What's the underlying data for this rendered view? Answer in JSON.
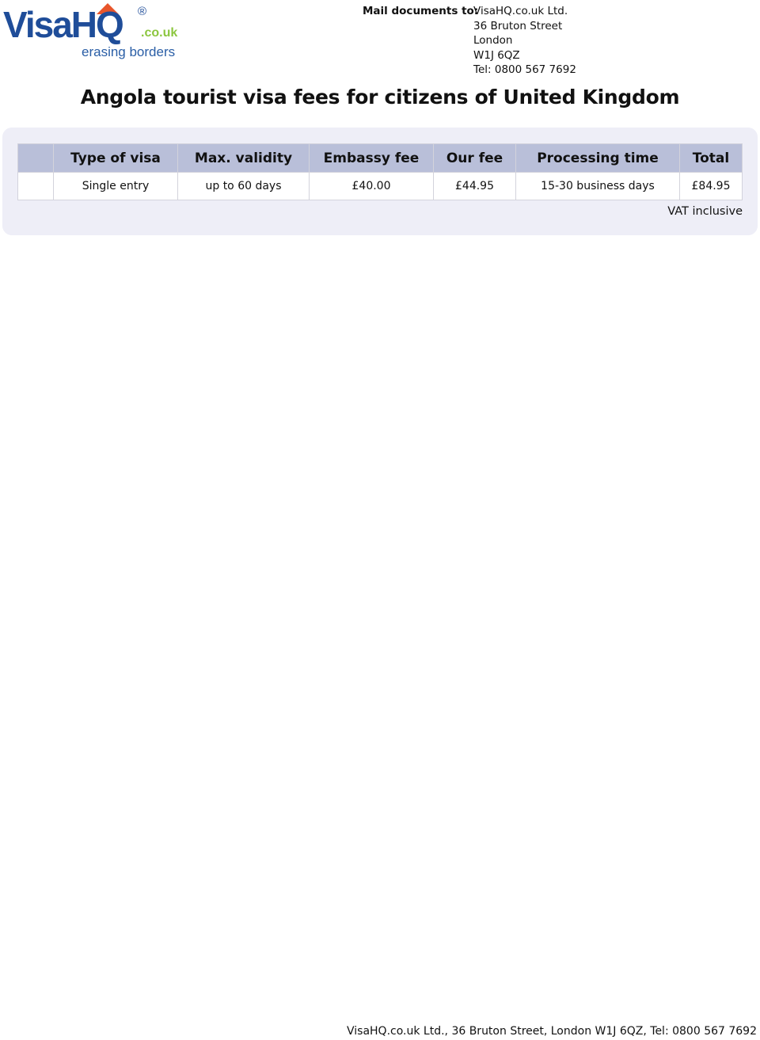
{
  "logo": {
    "brand": "VisaHQ",
    "registered_mark": "®",
    "domain_suffix": ".co.uk",
    "tagline": "erasing borders",
    "colors": {
      "primary": "#1f4d99",
      "accent_green": "#8cc63f",
      "accent_orange": "#e8552b"
    }
  },
  "mail": {
    "label": "Mail documents to:",
    "lines": [
      "VisaHQ.co.uk Ltd.",
      "36 Bruton Street",
      "London",
      "W1J 6QZ",
      "Tel: 0800 567 7692"
    ]
  },
  "title": "Angola tourist visa fees for citizens of United Kingdom",
  "fees_table": {
    "headers": [
      "",
      "Type of visa",
      "Max. validity",
      "Embassy fee",
      "Our fee",
      "Processing time",
      "Total"
    ],
    "rows": [
      [
        "",
        "Single entry",
        "up to 60 days",
        "£40.00",
        "£44.95",
        "15-30 business days",
        "£84.95"
      ]
    ],
    "note": "VAT inclusive",
    "colors": {
      "header_bg": "#b9bfd9",
      "panel_bg": "#eeeef7"
    }
  },
  "footer": "VisaHQ.co.uk Ltd., 36 Bruton Street, London W1J 6QZ, Tel: 0800 567 7692"
}
